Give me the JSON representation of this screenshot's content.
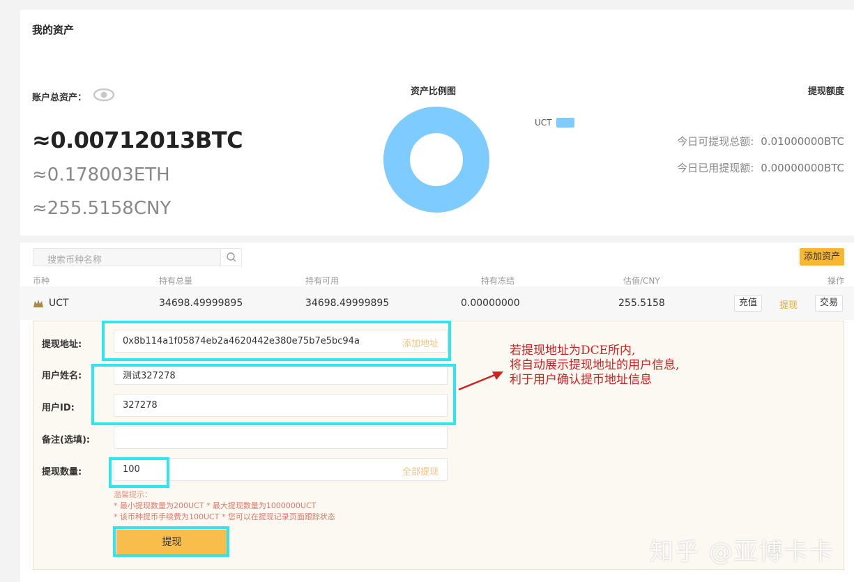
{
  "assets": {
    "title": "我的资产",
    "total_label": "账户总资产：",
    "btc": "≈0.00712013BTC",
    "eth": "≈0.178003ETH",
    "cny": "≈255.5158CNY"
  },
  "chart_data": {
    "type": "pie",
    "title": "资产比例图",
    "categories": [
      "UCT"
    ],
    "values": [
      100
    ],
    "colors": [
      "#7ecbff"
    ],
    "legend": "right"
  },
  "limit": {
    "title": "提现额度",
    "today_total_label": "今日可提现总额:",
    "today_total_value": "0.01000000BTC",
    "today_used_label": "今日已用提现额:",
    "today_used_value": "0.00000000BTC"
  },
  "list": {
    "search_placeholder": "搜索币种名称",
    "add_asset_label": "添加资产",
    "headers": [
      "币种",
      "持有总量",
      "持有可用",
      "持有冻结",
      "估值/CNY",
      "操作"
    ],
    "row": {
      "coin": "UCT",
      "total": "34698.49999895",
      "available": "34698.49999895",
      "frozen": "0.00000000",
      "cny": "255.5158",
      "deposit": "充值",
      "withdraw": "提现",
      "trade": "交易"
    }
  },
  "withdraw_form": {
    "address_label": "提现地址:",
    "address_value": "0x8b114a1f05874eb2a4620442e380e75b7e5bc94a",
    "add_address": "添加地址",
    "name_label": "用户姓名:",
    "name_value": "测试327278",
    "uid_label": "用户ID:",
    "uid_value": "327278",
    "remark_label": "备注(选填):",
    "amount_label": "提现数量:",
    "amount_value": "100",
    "withdraw_all": "全部提现",
    "tips_title": "温馨提示：",
    "tip1": "* 最小提现数量为200UCT    * 最大提现数量为1000000UCT",
    "tip2": "* 该币种提币手续费为100UCT    * 您可以在提现记录页面跟踪状态",
    "submit": "提现"
  },
  "annotation": {
    "line1": "若提现地址为DCE所内,",
    "line2": "将自动展示提现地址的用户信息,",
    "line3": "利于用户确认提币地址信息"
  },
  "watermark": "知乎 @亚博卡卡"
}
